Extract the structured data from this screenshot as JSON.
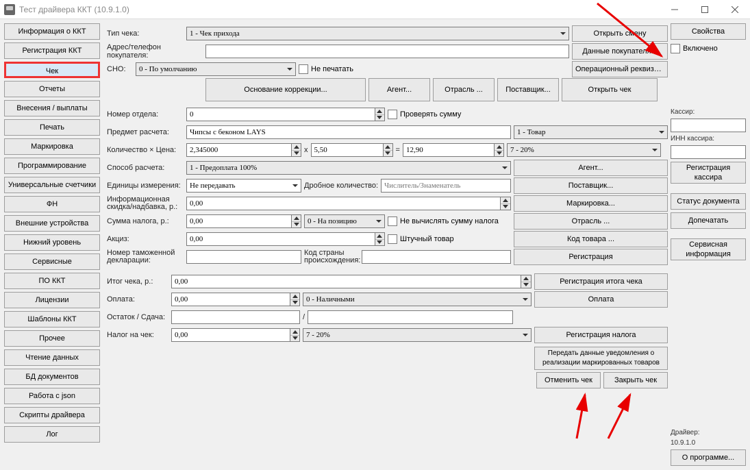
{
  "window": {
    "title": "Тест драйвера ККТ (10.9.1.0)"
  },
  "left": {
    "items": [
      "Информация о ККТ",
      "Регистрация ККТ",
      "Чек",
      "Отчеты",
      "Внесения / выплаты",
      "Печать",
      "Маркировка",
      "Программирование",
      "Универсальные счетчики",
      "ФН",
      "Внешние устройства",
      "Нижний уровень",
      "Сервисные",
      "ПО ККТ",
      "Лицензии",
      "Шаблоны ККТ",
      "Прочее",
      "Чтение данных",
      "БД документов",
      "Работа с json",
      "Скрипты драйвера",
      "Лог"
    ],
    "active_index": 2
  },
  "right": {
    "properties": "Свойства",
    "enabled_label": "Включено",
    "cashier_label": "Кассир:",
    "cashier_value": "",
    "inn_label": "ИНН кассира:",
    "inn_value": "",
    "reg_cashier": "Регистрация кассира",
    "doc_status": "Статус документа",
    "reprint": "Допечатать",
    "service_info": "Сервисная информация",
    "driver_label": "Драйвер:",
    "driver_ver": "10.9.1.0",
    "about": "О программе..."
  },
  "main": {
    "labels": {
      "type": "Тип чека:",
      "addr": "Адрес/телефон покупателя:",
      "sno": "СНО:",
      "dont_print": "Не печатать",
      "open_shift": "Открыть смену",
      "buyer_data": "Данные покупателя...",
      "op_req": "Операционный реквизит ...",
      "corr_base": "Основание коррекции...",
      "agent": "Агент...",
      "industry": "Отрасль ...",
      "supplier": "Поставщик...",
      "open_check": "Открыть чек",
      "dept": "Номер отдела:",
      "check_sum": "Проверять сумму",
      "subject": "Предмет расчета:",
      "qty_price": "Количество × Цена:",
      "x": "x",
      "eq": "=",
      "calc_method": "Способ расчета:",
      "agent2": "Агент...",
      "units": "Единицы измерения:",
      "frac_qty": "Дробное количество:",
      "frac_ph": "Числитель/Знаменатель",
      "supplier2": "Поставщик...",
      "info_discount": "Информационная скидка/надбавка, р.:",
      "marking": "Маркировка...",
      "tax_sum": "Сумма налога, р.:",
      "no_tax": "Не вычислять сумму налога",
      "industry2": "Отрасль ...",
      "excise": "Акциз:",
      "piece": "Штучный товар",
      "code": "Код товара ...",
      "customs": "Номер таможенной декларации:",
      "country": "Код страны происхождения:",
      "register": "Регистрация",
      "total": "Итог чека, р.:",
      "reg_total": "Регистрация итога чека",
      "payment": "Оплата:",
      "pay_btn": "Оплата",
      "remainder": "Остаток / Сдача:",
      "slash": "/",
      "check_tax": "Налог на чек:",
      "reg_tax": "Регистрация налога",
      "notify": "Передать данные уведомления о реализации маркированных товаров",
      "cancel": "Отменить чек",
      "close": "Закрыть чек"
    },
    "values": {
      "type": "1 - Чек прихода",
      "addr": "",
      "sno": "0 - По умолчанию",
      "dept": "0",
      "subject": "Чипсы с беконом LAYS",
      "subject_type": "1 - Товар",
      "qty": "2,345000",
      "price": "5,50",
      "total_line": "12,90",
      "tax_rate": "7 - 20%",
      "calc_method": "1 - Предоплата 100%",
      "units": "Не передавать",
      "discount": "0,00",
      "tax_sum": "0,00",
      "tax_mode": "0 - На позицию",
      "excise": "0,00",
      "customs": "",
      "country": "",
      "total": "0,00",
      "payment": "0,00",
      "pay_type": "0 - Наличными",
      "rem1": "",
      "rem2": "",
      "check_tax": "0,00",
      "check_tax_rate": "7 - 20%"
    }
  }
}
